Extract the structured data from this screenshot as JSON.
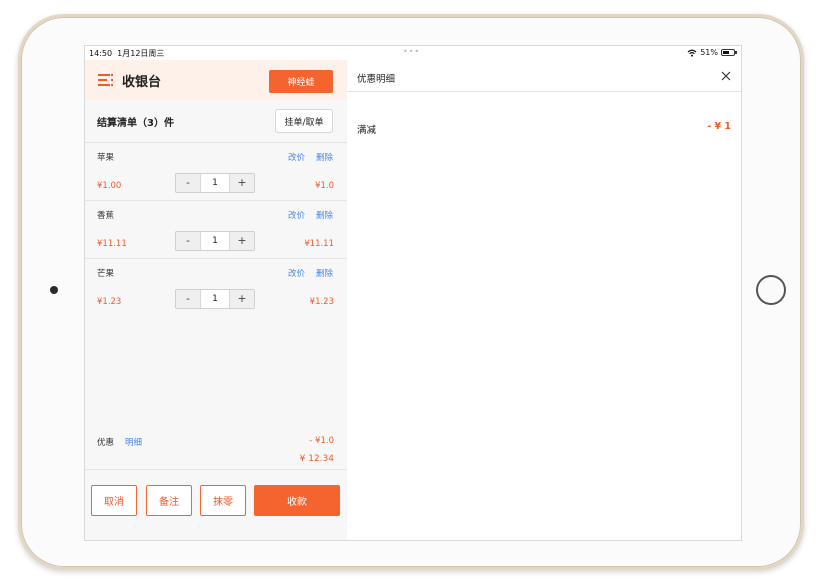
{
  "status_bar": {
    "time": "14:50",
    "date": "1月12日周三",
    "battery_pct": "51%"
  },
  "header": {
    "title": "收银台",
    "user_button": "神经蛙"
  },
  "order": {
    "title": "结算清单（3）件",
    "hold_button": "挂单/取单"
  },
  "items": [
    {
      "name": "苹果",
      "edit": "改价",
      "delete": "删除",
      "price": "¥1.00",
      "qty": "1",
      "total": "¥1.0"
    },
    {
      "name": "香蕉",
      "edit": "改价",
      "delete": "删除",
      "price": "¥11.11",
      "qty": "1",
      "total": "¥11.11"
    },
    {
      "name": "芒果",
      "edit": "改价",
      "delete": "删除",
      "price": "¥1.23",
      "qty": "1",
      "total": "¥1.23"
    }
  ],
  "stepper": {
    "minus": "-",
    "plus": "+"
  },
  "summary": {
    "discount_label": "优惠",
    "discount_link": "明细",
    "discount_amount": "- ¥1.0",
    "total": "¥ 12.34"
  },
  "actions": {
    "cancel": "取消",
    "note": "备注",
    "round_off": "抹零",
    "pay": "收款"
  },
  "discount_panel": {
    "title": "优惠明细",
    "row_label": "满减",
    "row_value": "- ¥ 1"
  },
  "colors": {
    "accent": "#f4642f",
    "link": "#4a86e8",
    "header_bg": "#fdf1ea"
  }
}
